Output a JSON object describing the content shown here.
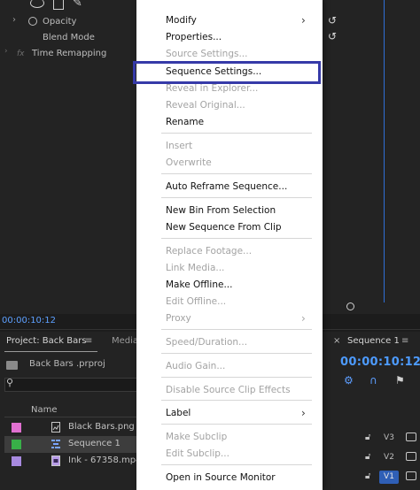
{
  "effect_controls": {
    "opacity_label": "Opacity",
    "blend_mode_label": "Blend Mode",
    "fx_label": "fx",
    "time_remapping_label": "Time Remapping"
  },
  "timecode_left": "00:00:10:12",
  "project_panel": {
    "tab_label": "Project: Back Bars",
    "menu_glyph": "≡",
    "media_tab_label": "Media",
    "project_file": "Back Bars .prproj",
    "column_name": "Name",
    "items": [
      {
        "name": "Black Bars.png",
        "color": "#e070d0"
      },
      {
        "name": "Sequence 1",
        "color": "#38b048"
      },
      {
        "name": "Ink - 67358.mp4",
        "color": "#a88ae0"
      }
    ]
  },
  "timeline_panel": {
    "close_glyph": "×",
    "tab_label": "Sequence 1",
    "menu_glyph": "≡",
    "timecode": "00:00:10:12",
    "tracks": [
      "V3",
      "V2",
      "V1"
    ]
  },
  "context_menu": {
    "items": [
      {
        "label": "Modify",
        "submenu": true,
        "disabled": false
      },
      {
        "label": "Properties...",
        "disabled": false
      },
      {
        "label": "Source Settings...",
        "disabled": true
      },
      {
        "label": "Sequence Settings...",
        "disabled": false,
        "highlighted": true
      },
      {
        "label": "Reveal in Explorer...",
        "disabled": true
      },
      {
        "label": "Reveal Original...",
        "disabled": true
      },
      {
        "label": "Rename",
        "disabled": false
      },
      {
        "label": "Insert",
        "disabled": true
      },
      {
        "label": "Overwrite",
        "disabled": true
      },
      {
        "label": "Auto Reframe Sequence...",
        "disabled": false
      },
      {
        "label": "New Bin From Selection",
        "disabled": false
      },
      {
        "label": "New Sequence From Clip",
        "disabled": false
      },
      {
        "label": "Replace Footage...",
        "disabled": true
      },
      {
        "label": "Link Media...",
        "disabled": true
      },
      {
        "label": "Make Offline...",
        "disabled": false
      },
      {
        "label": "Edit Offline...",
        "disabled": true
      },
      {
        "label": "Proxy",
        "submenu": true,
        "disabled": true
      },
      {
        "label": "Speed/Duration...",
        "disabled": true
      },
      {
        "label": "Audio Gain...",
        "disabled": true
      },
      {
        "label": "Disable Source Clip Effects",
        "disabled": true
      },
      {
        "label": "Label",
        "submenu": true,
        "disabled": false
      },
      {
        "label": "Make Subclip",
        "disabled": true
      },
      {
        "label": "Edit Subclip...",
        "disabled": true
      },
      {
        "label": "Open in Source Monitor",
        "disabled": false
      }
    ],
    "highlight_color": "#363aa8"
  }
}
